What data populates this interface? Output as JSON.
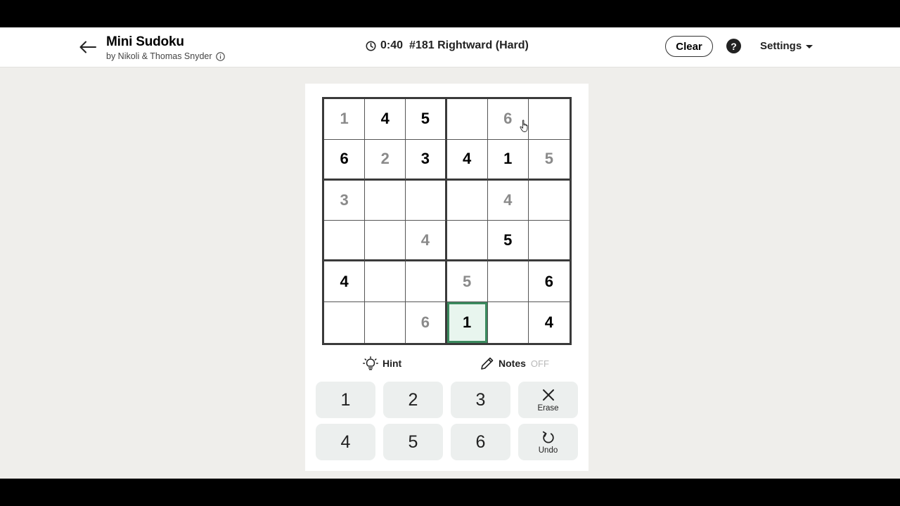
{
  "header": {
    "title": "Mini Sudoku",
    "byline": "by Nikoli & Thomas Snyder",
    "timer": "0:40",
    "puzzle_name": "#181 Rightward (Hard)",
    "clear_label": "Clear",
    "help_label": "?",
    "settings_label": "Settings"
  },
  "grid": {
    "rows": [
      [
        {
          "v": "1",
          "t": "user"
        },
        {
          "v": "4",
          "t": "given"
        },
        {
          "v": "5",
          "t": "given"
        },
        {
          "v": "",
          "t": "empty"
        },
        {
          "v": "6",
          "t": "user"
        },
        {
          "v": "",
          "t": "empty"
        }
      ],
      [
        {
          "v": "6",
          "t": "given"
        },
        {
          "v": "2",
          "t": "user"
        },
        {
          "v": "3",
          "t": "given"
        },
        {
          "v": "4",
          "t": "given"
        },
        {
          "v": "1",
          "t": "given"
        },
        {
          "v": "5",
          "t": "user"
        }
      ],
      [
        {
          "v": "3",
          "t": "user"
        },
        {
          "v": "",
          "t": "empty"
        },
        {
          "v": "",
          "t": "empty"
        },
        {
          "v": "",
          "t": "empty"
        },
        {
          "v": "4",
          "t": "user"
        },
        {
          "v": "",
          "t": "empty"
        }
      ],
      [
        {
          "v": "",
          "t": "empty"
        },
        {
          "v": "",
          "t": "empty"
        },
        {
          "v": "4",
          "t": "user"
        },
        {
          "v": "",
          "t": "empty"
        },
        {
          "v": "5",
          "t": "given"
        },
        {
          "v": "",
          "t": "empty"
        }
      ],
      [
        {
          "v": "4",
          "t": "given"
        },
        {
          "v": "",
          "t": "empty"
        },
        {
          "v": "",
          "t": "empty"
        },
        {
          "v": "5",
          "t": "user"
        },
        {
          "v": "",
          "t": "empty"
        },
        {
          "v": "6",
          "t": "given"
        }
      ],
      [
        {
          "v": "",
          "t": "empty"
        },
        {
          "v": "",
          "t": "empty"
        },
        {
          "v": "6",
          "t": "user"
        },
        {
          "v": "1",
          "t": "given"
        },
        {
          "v": "",
          "t": "empty"
        },
        {
          "v": "4",
          "t": "given"
        }
      ]
    ],
    "selected": {
      "row": 5,
      "col": 3
    },
    "given_color": "#000000",
    "user_color": "#8a8a8a",
    "selected_border_color": "#3b8a5e",
    "selected_fill_color": "#e8f5ee"
  },
  "tools": {
    "hint_label": "Hint",
    "notes_label": "Notes",
    "notes_state": "OFF"
  },
  "keypad": {
    "keys": [
      {
        "label": "1",
        "type": "digit"
      },
      {
        "label": "2",
        "type": "digit"
      },
      {
        "label": "3",
        "type": "digit"
      },
      {
        "label": "Erase",
        "type": "erase",
        "icon": "close-icon"
      },
      {
        "label": "4",
        "type": "digit"
      },
      {
        "label": "5",
        "type": "digit"
      },
      {
        "label": "6",
        "type": "digit"
      },
      {
        "label": "Undo",
        "type": "undo",
        "icon": "undo-icon"
      }
    ]
  },
  "colors": {
    "page_bg": "#efeeeb",
    "key_bg": "#ecefee"
  }
}
